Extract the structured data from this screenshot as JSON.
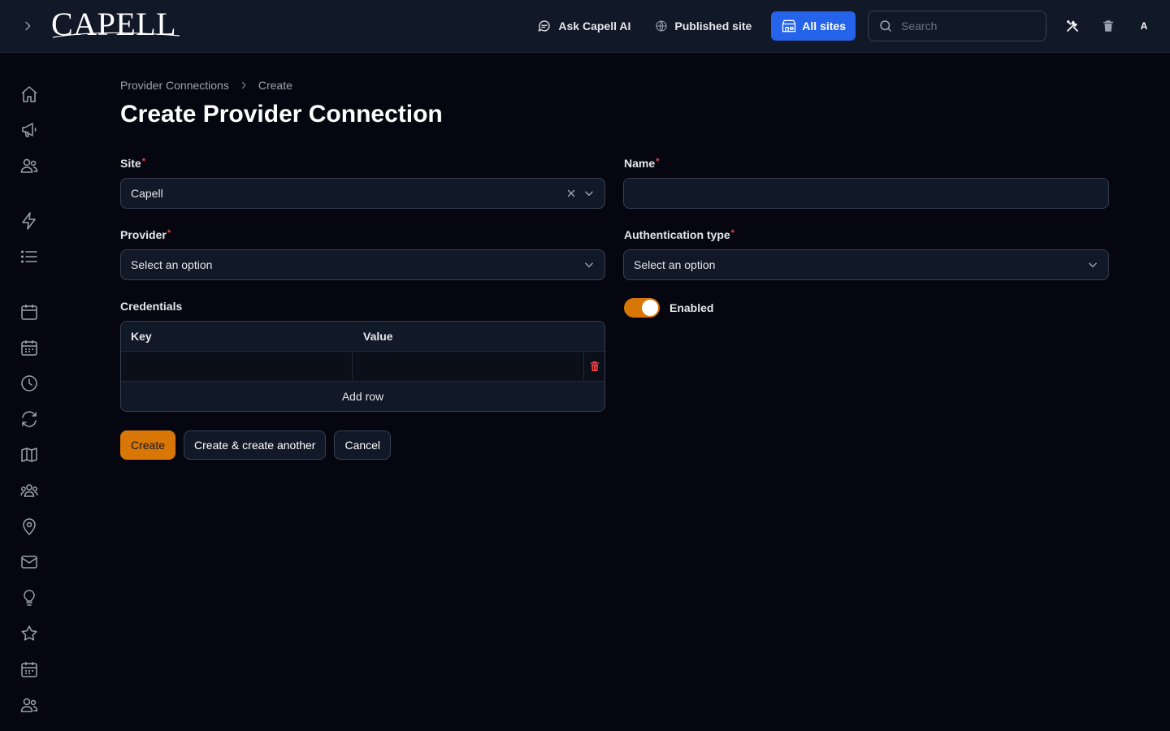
{
  "app": {
    "logo_text": "CAPELL"
  },
  "topbar": {
    "ask_ai_label": "Ask Capell AI",
    "published_site_label": "Published site",
    "all_sites_label": "All sites",
    "search_placeholder": "Search",
    "avatar_initial": "A"
  },
  "sidebar": {
    "items": [
      {
        "icon": "home-icon"
      },
      {
        "icon": "megaphone-icon"
      },
      {
        "icon": "users-icon"
      },
      {
        "icon": "bolt-icon"
      },
      {
        "icon": "list-icon"
      },
      {
        "icon": "calendar-icon"
      },
      {
        "icon": "calendar-days-icon"
      },
      {
        "icon": "clock-icon"
      },
      {
        "icon": "refresh-icon"
      },
      {
        "icon": "map-icon"
      },
      {
        "icon": "user-group-icon"
      },
      {
        "icon": "map-pin-icon"
      },
      {
        "icon": "envelope-icon"
      },
      {
        "icon": "light-bulb-icon"
      },
      {
        "icon": "star-icon"
      },
      {
        "icon": "calendar-days-icon"
      },
      {
        "icon": "users-icon"
      }
    ]
  },
  "breadcrumb": {
    "parent": "Provider Connections",
    "current": "Create"
  },
  "page": {
    "title": "Create Provider Connection"
  },
  "form": {
    "site": {
      "label": "Site",
      "required_mark": "*",
      "value": "Capell"
    },
    "name": {
      "label": "Name",
      "required_mark": "*",
      "value": ""
    },
    "provider": {
      "label": "Provider",
      "required_mark": "*",
      "placeholder": "Select an option"
    },
    "auth_type": {
      "label": "Authentication type",
      "required_mark": "*",
      "placeholder": "Select an option"
    },
    "credentials": {
      "label": "Credentials",
      "columns": [
        "Key",
        "Value"
      ],
      "rows": [
        {
          "key": "",
          "value": ""
        }
      ],
      "add_row_label": "Add row"
    },
    "enabled": {
      "label": "Enabled",
      "on": true
    }
  },
  "actions": {
    "create": "Create",
    "create_another": "Create & create another",
    "cancel": "Cancel"
  },
  "colors": {
    "accent": "#d97706",
    "primary_blue": "#2563eb",
    "danger": "#ef4444",
    "background": "#05060f",
    "surface": "#111827"
  }
}
